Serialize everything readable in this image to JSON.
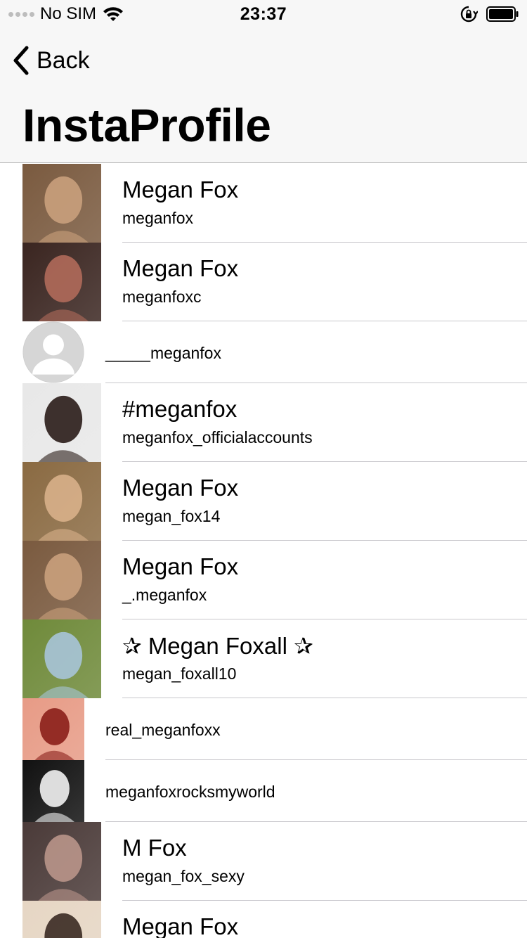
{
  "status_bar": {
    "carrier": "No SIM",
    "time": "23:37",
    "icons": [
      "signal-dots-icon",
      "wifi-icon",
      "orientation-lock-icon",
      "battery-icon"
    ]
  },
  "nav": {
    "back_label": "Back",
    "title": "InstaProfile",
    "background": "#f7f7f7"
  },
  "results": [
    {
      "name": "Megan Fox",
      "username": "meganfox",
      "avatar": "photo",
      "tone": [
        "#7a5a3f",
        "#c9a07c"
      ]
    },
    {
      "name": "Megan Fox",
      "username": "meganfoxc",
      "avatar": "photo",
      "tone": [
        "#3a2520",
        "#b06a5a"
      ]
    },
    {
      "name": "",
      "username": "_____meganfox",
      "avatar": "placeholder",
      "tone": [
        "#d6d6d6",
        "#ffffff"
      ]
    },
    {
      "name": "#meganfox",
      "username": "meganfox_officialaccounts",
      "avatar": "photo",
      "tone": [
        "#e8e8e8",
        "#2a1c18"
      ]
    },
    {
      "name": "Megan Fox",
      "username": "megan_fox14",
      "avatar": "photo",
      "tone": [
        "#8a6a42",
        "#d8b08a"
      ]
    },
    {
      "name": "Megan Fox",
      "username": "_.meganfox",
      "avatar": "photo",
      "tone": [
        "#7a5a3f",
        "#c9a07c"
      ]
    },
    {
      "name": "✰ Megan Foxall ✰",
      "username": "megan_foxall10",
      "avatar": "photo",
      "tone": [
        "#6f8a3a",
        "#a7c4d8"
      ]
    },
    {
      "name": "",
      "username": "real_meganfoxx",
      "avatar": "photo",
      "tone": [
        "#e79b86",
        "#8b1f1a"
      ]
    },
    {
      "name": "",
      "username": "meganfoxrocksmyworld",
      "avatar": "photo",
      "tone": [
        "#111111",
        "#f2f2f2"
      ]
    },
    {
      "name": "M Fox",
      "username": "megan_fox_sexy",
      "avatar": "photo",
      "tone": [
        "#4a3a38",
        "#b9958a"
      ]
    },
    {
      "name": "Megan Fox",
      "username": "",
      "avatar": "photo",
      "tone": [
        "#e6d6c4",
        "#3a2a22"
      ]
    }
  ]
}
